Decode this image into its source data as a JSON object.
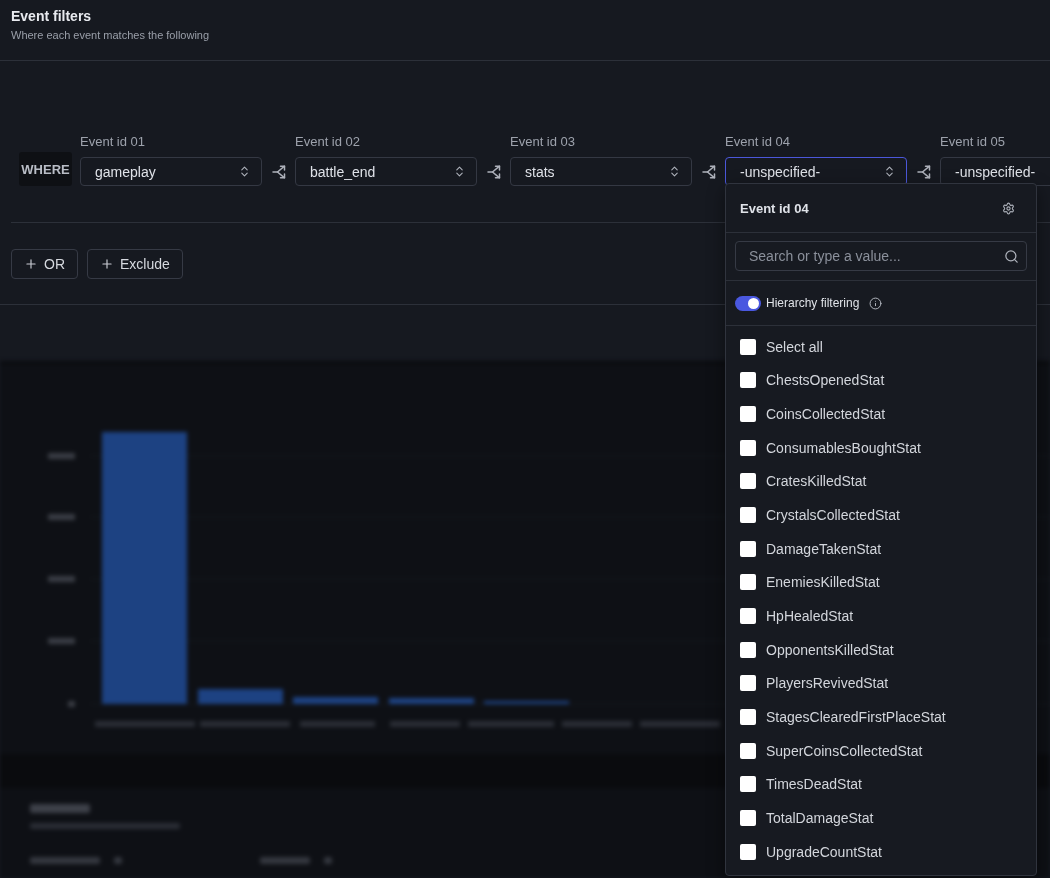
{
  "header": {
    "title": "Event filters",
    "subtitle": "Where each event matches the following"
  },
  "filter": {
    "keyword": "WHERE",
    "fields": [
      {
        "label": "Event id 01",
        "value": "gameplay",
        "open": false
      },
      {
        "label": "Event id 02",
        "value": "battle_end",
        "open": false
      },
      {
        "label": "Event id 03",
        "value": "stats",
        "open": false
      },
      {
        "label": "Event id 04",
        "value": "-unspecified-",
        "open": true
      },
      {
        "label": "Event id 05",
        "value": "-unspecified-",
        "open": false
      }
    ]
  },
  "actions": [
    {
      "label": "OR"
    },
    {
      "label": "Exclude"
    }
  ],
  "dropdown": {
    "title": "Event id 04",
    "search": {
      "placeholder": "Search or type a value..."
    },
    "hierarchy_filtering": {
      "label": "Hierarchy filtering",
      "on": true
    },
    "options": [
      {
        "label": "Select all",
        "checked": false
      },
      {
        "label": "ChestsOpenedStat",
        "checked": false
      },
      {
        "label": "CoinsCollectedStat",
        "checked": false
      },
      {
        "label": "ConsumablesBoughtStat",
        "checked": false
      },
      {
        "label": "CratesKilledStat",
        "checked": false
      },
      {
        "label": "CrystalsCollectedStat",
        "checked": false
      },
      {
        "label": "DamageTakenStat",
        "checked": false
      },
      {
        "label": "EnemiesKilledStat",
        "checked": false
      },
      {
        "label": "HpHealedStat",
        "checked": false
      },
      {
        "label": "OpponentsKilledStat",
        "checked": false
      },
      {
        "label": "PlayersRevivedStat",
        "checked": false
      },
      {
        "label": "StagesClearedFirstPlaceStat",
        "checked": false
      },
      {
        "label": "SuperCoinsCollectedStat",
        "checked": false
      },
      {
        "label": "TimesDeadStat",
        "checked": false
      },
      {
        "label": "TotalDamageStat",
        "checked": false
      },
      {
        "label": "UpgradeCountStat",
        "checked": false
      }
    ]
  }
}
